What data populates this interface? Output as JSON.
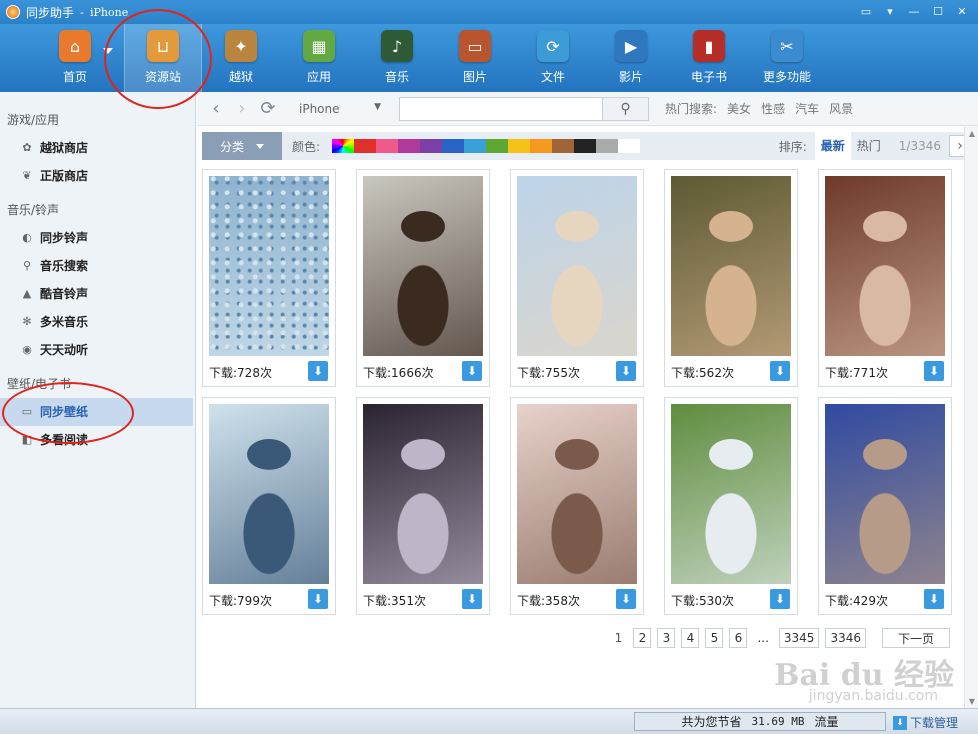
{
  "window": {
    "app_name": "同步助手",
    "title_sep": "-",
    "device": "iPhone"
  },
  "toolbar": {
    "items": [
      {
        "label": "首页",
        "icon": "home-icon",
        "color": "#e8792d",
        "glyph": "⌂"
      },
      {
        "label": "资源站",
        "icon": "shopping-bag-icon",
        "color": "#e39a3b",
        "glyph": "⊔",
        "active": true
      },
      {
        "label": "越狱",
        "icon": "pineapple-icon",
        "color": "#b9853f",
        "glyph": "✦"
      },
      {
        "label": "应用",
        "icon": "apps-icon",
        "color": "#62a843",
        "glyph": "▦"
      },
      {
        "label": "音乐",
        "icon": "music-icon",
        "color": "#2e5a38",
        "glyph": "♪"
      },
      {
        "label": "图片",
        "icon": "picture-icon",
        "color": "#b8552f",
        "glyph": "▭"
      },
      {
        "label": "文件",
        "icon": "file-sync-icon",
        "color": "#3c9bd6",
        "glyph": "⟳"
      },
      {
        "label": "影片",
        "icon": "video-icon",
        "color": "#2f78c0",
        "glyph": "▶"
      },
      {
        "label": "电子书",
        "icon": "book-icon",
        "color": "#b72d28",
        "glyph": "▮"
      },
      {
        "label": "更多功能",
        "icon": "tools-icon",
        "color": "#3b8bd0",
        "glyph": "✂"
      }
    ]
  },
  "sidebar": {
    "sections": [
      {
        "title": "游戏/应用",
        "items": [
          {
            "label": "越狱商店",
            "icon": "pineapple-icon",
            "glyph": "✿"
          },
          {
            "label": "正版商店",
            "icon": "leaf-icon",
            "glyph": "❦"
          }
        ]
      },
      {
        "title": "音乐/铃声",
        "items": [
          {
            "label": "同步铃声",
            "icon": "speaker-icon",
            "glyph": "◐"
          },
          {
            "label": "音乐搜索",
            "icon": "search-icon",
            "glyph": "⚲"
          },
          {
            "label": "酷音铃声",
            "icon": "bell-icon",
            "glyph": "▲"
          },
          {
            "label": "多米音乐",
            "icon": "star-icon",
            "glyph": "✻"
          },
          {
            "label": "天天动听",
            "icon": "headphone-icon",
            "glyph": "◉"
          }
        ]
      },
      {
        "title": "壁纸/电子书",
        "items": [
          {
            "label": "同步壁纸",
            "icon": "wallpaper-icon",
            "glyph": "▭",
            "active": true
          },
          {
            "label": "多看阅读",
            "icon": "reader-icon",
            "glyph": "◧"
          }
        ]
      }
    ]
  },
  "navbar": {
    "device_select": "iPhone",
    "search_value": "",
    "hot_label": "热门搜索:",
    "hot_items": [
      "美女",
      "性感",
      "汽车",
      "风景"
    ]
  },
  "filter": {
    "category_label": "分类",
    "color_label": "颜色:",
    "swatches": [
      "#ff4fa0",
      "#e0302c",
      "#ef5a8a",
      "#b03a9c",
      "#7c3fa8",
      "#2a63c7",
      "#3aa0d8",
      "#5da833",
      "#f5c218",
      "#f59a1e",
      "#a06536",
      "#222222",
      "#aaaaaa",
      "#ffffff"
    ],
    "sort_label": "排序:",
    "sort_options": [
      "最新",
      "热门"
    ],
    "active_sort": "最新",
    "page_count": "1/3346",
    "next_glyph": "›"
  },
  "wallpapers": [
    {
      "downloads": "下载:728次",
      "palette": [
        "#8eb3cf",
        "#bfd6e6"
      ],
      "subject": "rain drops glass"
    },
    {
      "downloads": "下载:1666次",
      "palette": [
        "#c9c7bf",
        "#3b2a20"
      ],
      "subject": "woman leopard jacket"
    },
    {
      "downloads": "下载:755次",
      "palette": [
        "#bcd4ea",
        "#e6d6c0"
      ],
      "subject": "woman holding fishbowl beach"
    },
    {
      "downloads": "下载:562次",
      "palette": [
        "#5c5a34",
        "#d6b38f"
      ],
      "subject": "woman with flowers"
    },
    {
      "downloads": "下载:771次",
      "palette": [
        "#6e3a2a",
        "#d9b8a4"
      ],
      "subject": "woman short hair"
    },
    {
      "downloads": "下载:799次",
      "palette": [
        "#cfe2ec",
        "#3a5878"
      ],
      "subject": "woman sitting denim"
    },
    {
      "downloads": "下载:351次",
      "palette": [
        "#2a2330",
        "#bfb5c9"
      ],
      "subject": "fantasy warrior woman"
    },
    {
      "downloads": "下载:358次",
      "palette": [
        "#e8d2cb",
        "#7b5a4c"
      ],
      "subject": "woman floral dress"
    },
    {
      "downloads": "下载:530次",
      "palette": [
        "#5f8d3e",
        "#e6ecef"
      ],
      "subject": "woman sitting on grass"
    },
    {
      "downloads": "下载:429次",
      "palette": [
        "#2f4aa0",
        "#b59b88"
      ],
      "subject": "woman blue dress"
    }
  ],
  "pager": {
    "pages": [
      "1",
      "2",
      "3",
      "4",
      "5",
      "6",
      "...",
      "3345",
      "3346"
    ],
    "current": "1",
    "next_label": "下一页"
  },
  "statusbar": {
    "traffic_label": "共为您节省",
    "traffic_value": "31.69 MB",
    "traffic_unit": "流量",
    "download_manager": "下载管理"
  },
  "watermark": {
    "brand": "Bai du 经验",
    "url": "jingyan.baidu.com"
  }
}
